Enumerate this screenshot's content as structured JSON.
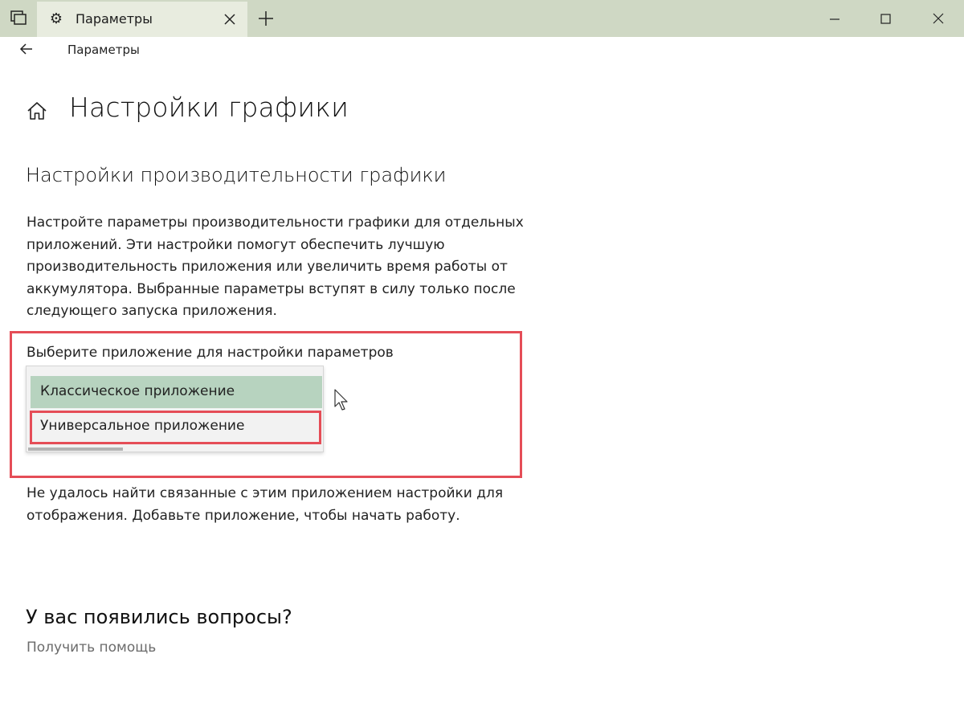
{
  "window": {
    "tab_title": "Параметры",
    "nav_title": "Параметры"
  },
  "page": {
    "title": "Настройки графики",
    "section_title": "Настройки производительности графики",
    "description": "Настройте параметры производительности графики для отдельных приложений. Эти настройки помогут обеспечить лучшую производительность приложения или увеличить время работы от аккумулятора. Выбранные параметры вступят в силу только после следующего запуска приложения.",
    "select_label": "Выберите приложение для настройки параметров",
    "dropdown_options": [
      "Классическое приложение",
      "Универсальное приложение"
    ],
    "error_text": "Не удалось найти связанные с этим приложением настройки для отображения. Добавьте приложение, чтобы начать работу."
  },
  "help": {
    "title": "У вас появились вопросы?",
    "link": "Получить помощь"
  },
  "colors": {
    "titlebar": "#cfd8c4",
    "selected_option": "#b7d3bf",
    "highlight": "#e54d57"
  }
}
